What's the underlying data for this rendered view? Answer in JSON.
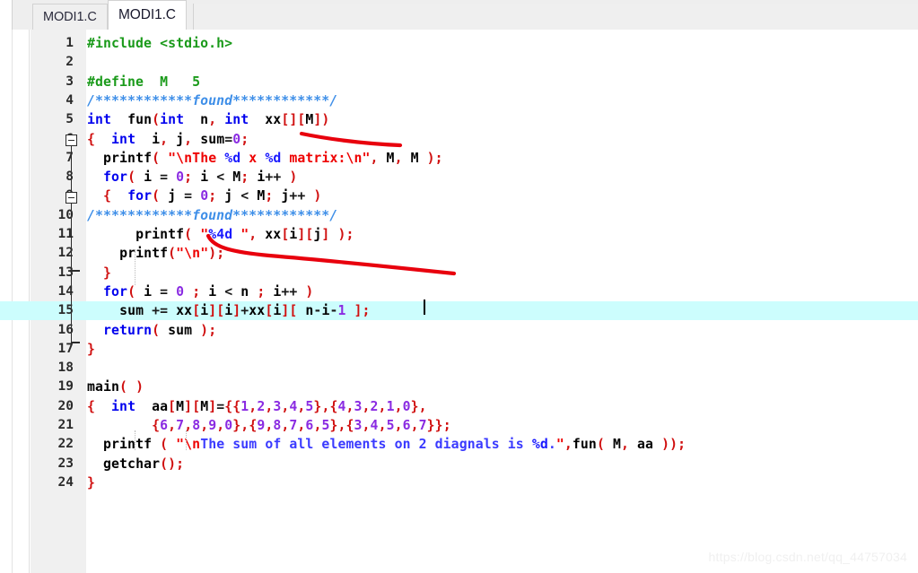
{
  "tabs": [
    {
      "label": "MODI1.C",
      "active": false
    },
    {
      "label": "MODI1.C",
      "active": true
    }
  ],
  "watermark": "https://blog.csdn.net/qq_44757034",
  "editor": {
    "highlighted_line": 15,
    "caret_line": 15,
    "language": "C",
    "line_count": 24,
    "highlight_color": "#ccfdfd"
  },
  "code": {
    "lines": [
      {
        "n": "1",
        "text": "#include <stdio.h>"
      },
      {
        "n": "2",
        "text": ""
      },
      {
        "n": "3",
        "text": "#define  M   5"
      },
      {
        "n": "4",
        "text": "/************found************/"
      },
      {
        "n": "5",
        "text": "int  fun(int  n, int  xx[][M])"
      },
      {
        "n": "6",
        "text": "{  int  i, j, sum=0;"
      },
      {
        "n": "7",
        "text": "  printf( \"\\nThe %d x %d matrix:\\n\", M, M );"
      },
      {
        "n": "8",
        "text": "  for( i = 0; i < M; i++ )"
      },
      {
        "n": "9",
        "text": "  {  for( j = 0; j < M; j++ )"
      },
      {
        "n": "10",
        "text": "/************found************/"
      },
      {
        "n": "11",
        "text": "      printf( \"%4d \", xx[i][j] );"
      },
      {
        "n": "12",
        "text": "    printf(\"\\n\");"
      },
      {
        "n": "13",
        "text": "  }"
      },
      {
        "n": "14",
        "text": "  for( i = 0 ; i < n ; i++ )"
      },
      {
        "n": "15",
        "text": "    sum += xx[i][i]+xx[i][ n-i-1 ];"
      },
      {
        "n": "16",
        "text": "  return( sum );"
      },
      {
        "n": "17",
        "text": "}"
      },
      {
        "n": "18",
        "text": ""
      },
      {
        "n": "19",
        "text": "main( )"
      },
      {
        "n": "20",
        "text": "{  int  aa[M][M]={{1,2,3,4,5},{4,3,2,1,0},"
      },
      {
        "n": "21",
        "text": "        {6,7,8,9,0},{9,8,7,6,5},{3,4,5,6,7}};"
      },
      {
        "n": "22",
        "text": "  printf ( \"\\nThe sum of all elements on 2 diagnals is %d.\",fun( M, aa ));"
      },
      {
        "n": "23",
        "text": "  getchar();"
      },
      {
        "n": "24",
        "text": "}"
      }
    ]
  },
  "colors": {
    "keyword": "#0000ee",
    "preprocessor": "#1a9a1a",
    "string": "#ee0000",
    "format_specifier": "#1a1aff",
    "number": "#8a2be2",
    "identifier_red": "#d01010",
    "comment": "#3f8fe8",
    "annotation_stroke": "#e8000d",
    "gutter_bg": "#f0f0f0",
    "tab_bg": "#efefef"
  },
  "annotations": [
    {
      "name": "red-underline-stroke-1"
    },
    {
      "name": "red-underline-stroke-2"
    }
  ]
}
